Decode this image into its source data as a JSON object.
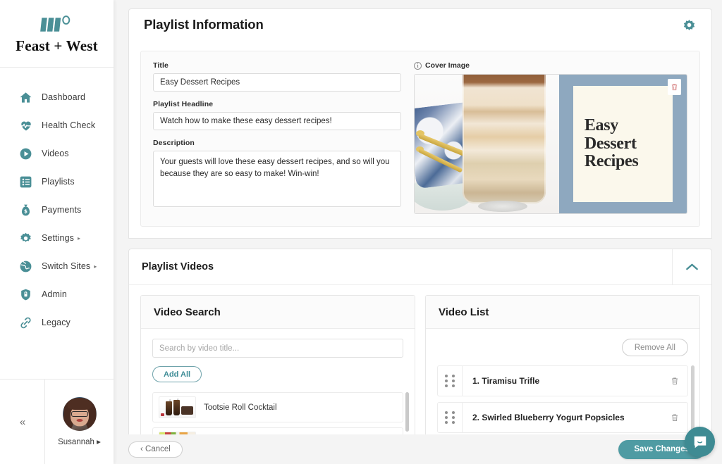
{
  "brand": {
    "name": "Feast + West",
    "logo_icon": "feast-west-logo"
  },
  "sidebar": {
    "items": [
      {
        "label": "Dashboard",
        "icon": "home-icon",
        "has_caret": false
      },
      {
        "label": "Health Check",
        "icon": "heartbeat-icon",
        "has_caret": false
      },
      {
        "label": "Videos",
        "icon": "play-circle-icon",
        "has_caret": false
      },
      {
        "label": "Playlists",
        "icon": "list-icon",
        "has_caret": false
      },
      {
        "label": "Payments",
        "icon": "money-bag-icon",
        "has_caret": false
      },
      {
        "label": "Settings",
        "icon": "gear-icon",
        "has_caret": true
      },
      {
        "label": "Switch Sites",
        "icon": "globe-icon",
        "has_caret": true
      },
      {
        "label": "Admin",
        "icon": "shield-lock-icon",
        "has_caret": false
      },
      {
        "label": "Legacy",
        "icon": "link-icon",
        "has_caret": false
      }
    ],
    "collapse_label": "«",
    "user": {
      "name": "Susannah",
      "caret": "▸",
      "avatar_icon": "user-avatar"
    }
  },
  "header": {
    "title": "Playlist Information",
    "settings_icon": "gear-icon"
  },
  "form": {
    "title": {
      "label": "Title",
      "value": "Easy Dessert Recipes"
    },
    "headline": {
      "label": "Playlist Headline",
      "value": "Watch how to make these easy dessert recipes!"
    },
    "description": {
      "label": "Description",
      "value": "Your guests will love these easy dessert recipes, and so will you because they are so easy to make! Win-win!"
    }
  },
  "cover": {
    "label": "Cover Image",
    "info_icon": "info-icon",
    "delete_icon": "trash-icon",
    "caption_line1": "Easy",
    "caption_line2": "Dessert",
    "caption_line3": "Recipes",
    "accent_band_color": "#8ea8bf",
    "caption_bg_color": "#fbf8ec"
  },
  "playlist_videos": {
    "title": "Playlist Videos",
    "collapse_icon": "chevron-up-icon",
    "search_panel": {
      "title": "Video Search",
      "search_placeholder": "Search by video title...",
      "search_value": "",
      "add_all_label": "Add All",
      "results": [
        {
          "title": "Tootsie Roll Cocktail",
          "thumb": "cocktail-thumb"
        },
        {
          "title": "",
          "thumb": "fruit-thumb"
        }
      ]
    },
    "list_panel": {
      "title": "Video List",
      "remove_all_label": "Remove All",
      "items": [
        {
          "label": "1. Tiramisu Trifle",
          "drag_icon": "drag-handle-icon",
          "delete_icon": "trash-icon"
        },
        {
          "label": "2. Swirled Blueberry Yogurt Popsicles",
          "drag_icon": "drag-handle-icon",
          "delete_icon": "trash-icon"
        }
      ]
    }
  },
  "footer": {
    "cancel_label": "‹ Cancel",
    "save_label": "Save Changes",
    "chat_icon": "chat-bubble-icon"
  },
  "colors": {
    "accent_teal": "#4a8f96",
    "save_button": "#4f9ba3",
    "chat_button": "#3e8b93",
    "page_background": "#f4f4f4",
    "trash_red": "#d98b8b"
  }
}
